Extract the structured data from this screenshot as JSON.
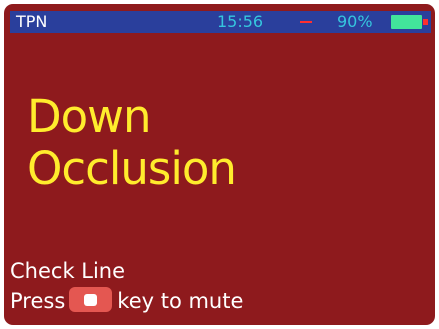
{
  "status_bar": {
    "app_label": "TPN",
    "time": "15:56",
    "battery_percent": "90%",
    "battery_level": 0.9,
    "alarm_indicator_color": "#ff2f2f",
    "battery_color": "#42e59b",
    "background_color": "#2a3f9c",
    "icons": [
      "alarm-dash-icon",
      "battery-icon"
    ]
  },
  "alarm": {
    "title_line_1": "Down",
    "title_line_2": "Occlusion",
    "title_color": "#ffec2d",
    "background_color": "#8e1a1d"
  },
  "instructions": {
    "check_line": "Check Line",
    "press": "Press",
    "mute_suffix": "key to mute",
    "mute_key_color": "#e45751",
    "mute_key_icon": "white-square-icon"
  }
}
